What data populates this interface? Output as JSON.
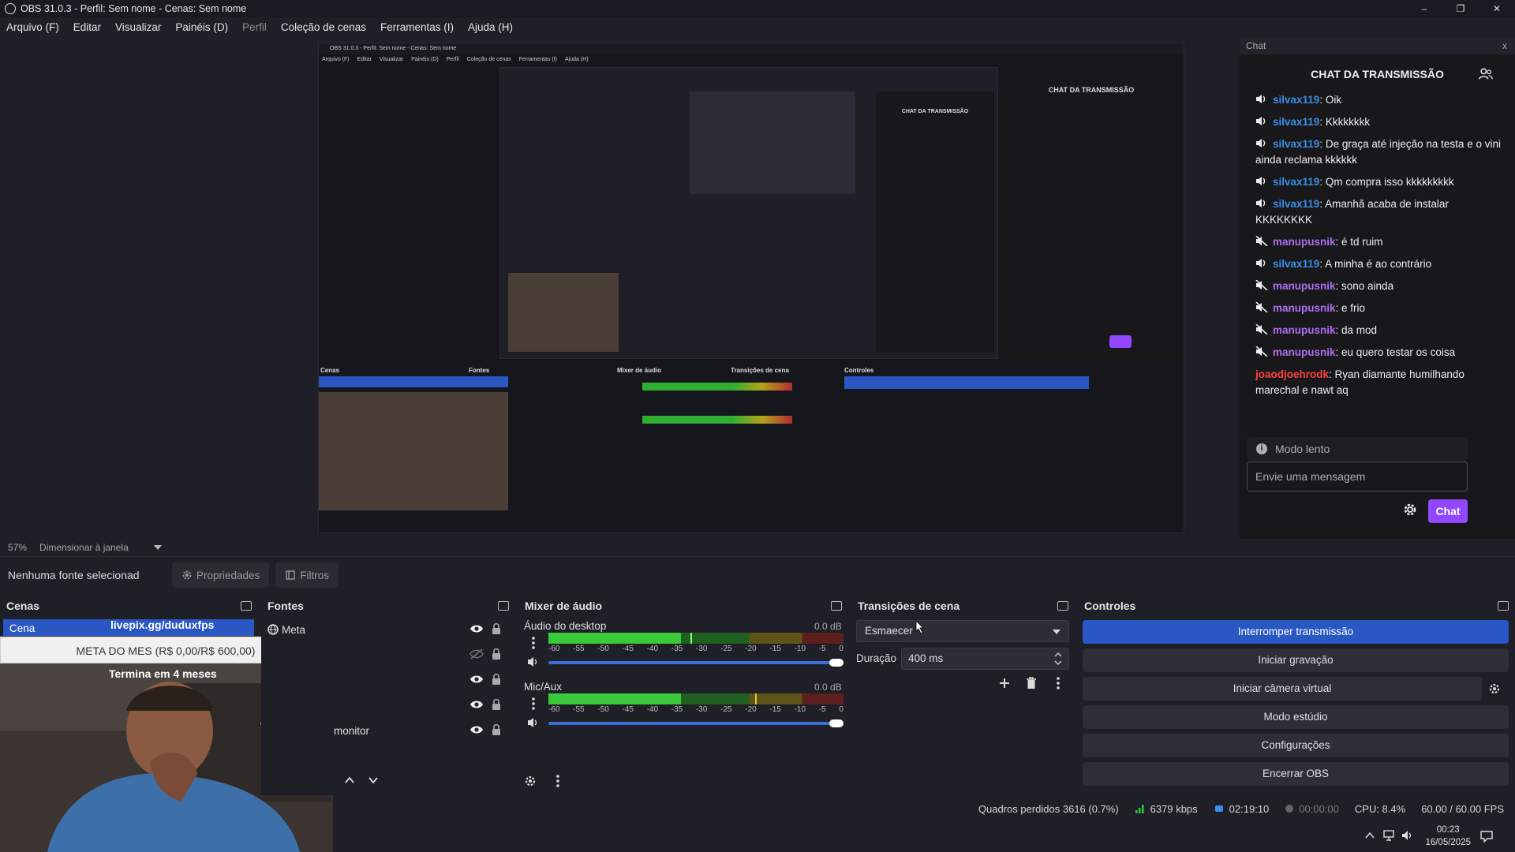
{
  "window": {
    "title": "OBS 31.0.3 - Perfil: Sem nome - Cenas: Sem nome",
    "minimize": "–",
    "maximize": "❐",
    "close": "✕"
  },
  "menu": [
    "Arquivo (F)",
    "Editar",
    "Visualizar",
    "Painéis (D)",
    "Perfil",
    "Coleção de cenas",
    "Ferramentas (I)",
    "Ajuda (H)"
  ],
  "nested_preview": {
    "title": "OBS 31.0.3 - Perfil: Sem nome - Cenas: Sem nome",
    "menu": [
      "Arquivo (F)",
      "Editar",
      "Visualizar",
      "Painéis (D)",
      "Perfil",
      "Coleção de cenas",
      "Ferramentas (I)",
      "Ajuda (H)"
    ],
    "docks": [
      "Cenas",
      "Fontes",
      "Mixer de áudio",
      "Transições de cena",
      "Controles"
    ],
    "chat_title": "CHAT DA TRANSMISSÃO"
  },
  "chat": {
    "dock_title": "Chat",
    "dock_close": "x",
    "header": "CHAT DA TRANSMISSÃO",
    "messages": [
      {
        "user": "silvax119",
        "text": ": Oik",
        "color": "#3a8fe8",
        "icon": "speaker-icon"
      },
      {
        "user": "silvax119",
        "text": ": Kkkkkkkk",
        "color": "#3a8fe8",
        "icon": "speaker-icon"
      },
      {
        "user": "silvax119",
        "text": ": De graça até injeção na testa e o vini ainda reclama kkkkkk",
        "color": "#3a8fe8",
        "icon": "speaker-icon"
      },
      {
        "user": "silvax119",
        "text": ": Qm compra isso kkkkkkkkk",
        "color": "#3a8fe8",
        "icon": "speaker-icon"
      },
      {
        "user": "silvax119",
        "text": ": Amanhã acaba de instalar KKKKKKKK",
        "color": "#3a8fe8",
        "icon": "speaker-icon"
      },
      {
        "user": "manupusnik",
        "text": ": é td ruim",
        "color": "#b36cf0",
        "icon": "muted-icon"
      },
      {
        "user": "silvax119",
        "text": ": A minha é ao contrário",
        "color": "#3a8fe8",
        "icon": "speaker-icon"
      },
      {
        "user": "manupusnik",
        "text": ": sono ainda",
        "color": "#b36cf0",
        "icon": "muted-icon"
      },
      {
        "user": "manupusnik",
        "text": ": e frio",
        "color": "#b36cf0",
        "icon": "muted-icon"
      },
      {
        "user": "manupusnik",
        "text": ": da mod",
        "color": "#b36cf0",
        "icon": "muted-icon"
      },
      {
        "user": "manupusnik",
        "text": ": eu quero testar os coisa",
        "color": "#b36cf0",
        "icon": "muted-icon"
      },
      {
        "user": "joaodjoehrodk",
        "text": ": Ryan diamante humilhando marechal e nawt aq",
        "color": "#ff4040",
        "icon": ""
      }
    ],
    "slow_mode": "Modo lento",
    "input_placeholder": "Envie uma mensagem",
    "chat_button": "Chat",
    "accent": "#9147ff"
  },
  "preview": {
    "zoom": "57%",
    "zoom_mode": "Dimensionar à janela"
  },
  "source_toolbar": {
    "no_source": "Nenhuma fonte selecionad",
    "properties": "Propriedades",
    "filters": "Filtros"
  },
  "scenes": {
    "title": "Cenas",
    "items": [
      "Cena"
    ],
    "overlay_link": "livepix.gg/duduxfps",
    "overlay_meta": "META DO MES (R$ 0,00/R$ 600,00)",
    "overlay_termina": "Termina em 4 meses"
  },
  "sources": {
    "title": "Fontes",
    "items": [
      {
        "label": "Meta",
        "visible": true
      },
      {
        "label": "",
        "visible": false
      },
      {
        "label": "",
        "visible": true
      },
      {
        "label": "",
        "visible": true
      },
      {
        "label": "monitor",
        "visible": true
      }
    ]
  },
  "mixer": {
    "title": "Mixer de áudio",
    "ticks": [
      "-60",
      "-55",
      "-50",
      "-45",
      "-40",
      "-35",
      "-30",
      "-25",
      "-20",
      "-15",
      "-10",
      "-5",
      "0"
    ],
    "channels": [
      {
        "name": "Áudio do desktop",
        "db": "0.0 dB",
        "level": 0.45,
        "peak": 0.48
      },
      {
        "name": "Mic/Aux",
        "db": "0.0 dB",
        "level": 0.45,
        "peak": 0.7
      }
    ]
  },
  "transitions": {
    "title": "Transições de cena",
    "selected": "Esmaecer",
    "duration_label": "Duração",
    "duration_value": "400 ms"
  },
  "controls": {
    "title": "Controles",
    "buttons": [
      "Interromper transmissão",
      "Iniciar gravação",
      "Iniciar câmera virtual",
      "Modo estúdio",
      "Configurações",
      "Encerrar OBS"
    ]
  },
  "status": {
    "dropped": "Quadros perdidos 3616 (0.7%)",
    "bitrate": "6379 kbps",
    "live_time": "02:19:10",
    "rec_time": "00:00:00",
    "cpu": "CPU: 8.4%",
    "fps": "60.00 / 60.00 FPS"
  },
  "taskbar": {
    "time": "00:23",
    "date": "16/05/2025"
  }
}
